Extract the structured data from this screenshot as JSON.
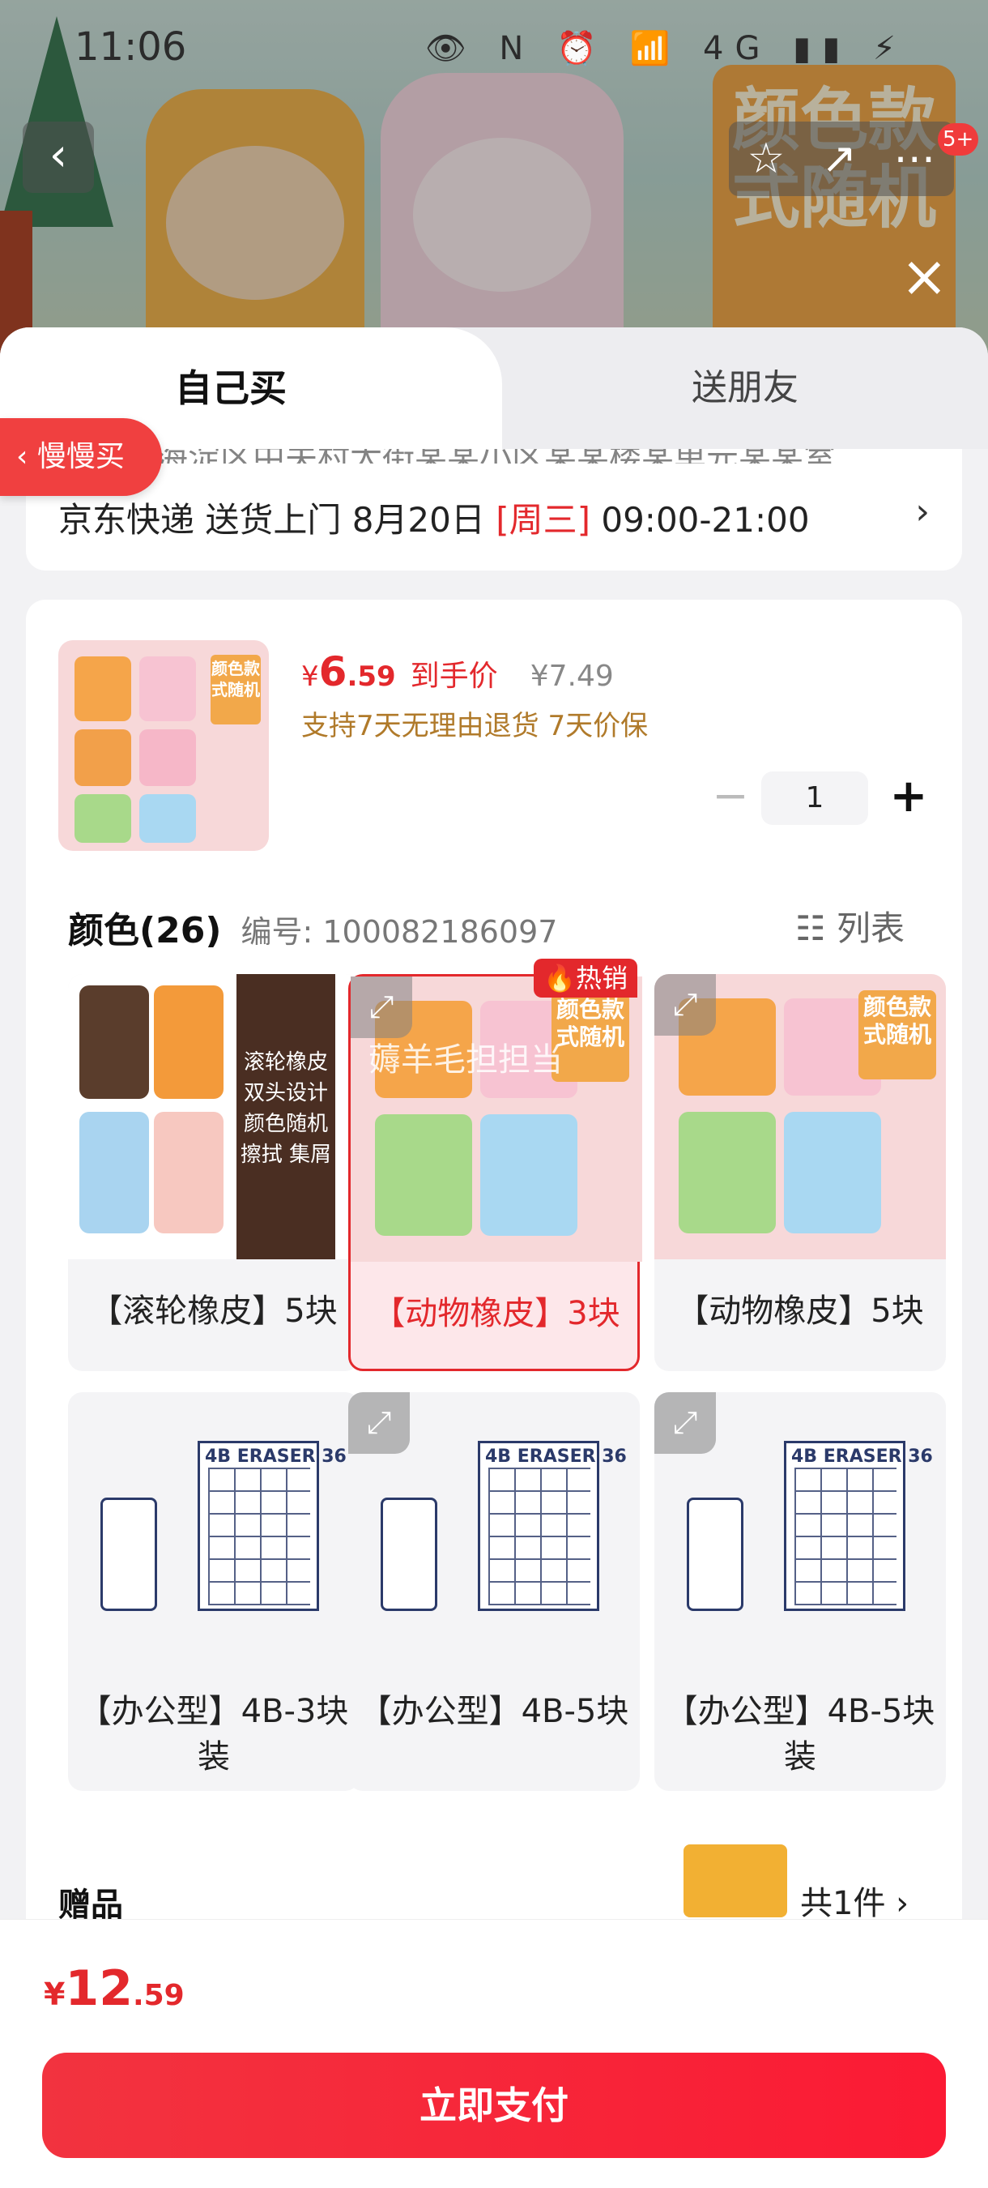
{
  "status_bar": {
    "time": "11:06",
    "icons_text": "👁 N ⏰ 📶 4G ▮▮ ⚡"
  },
  "header": {
    "back_icon": "‹",
    "actions": [
      "☆",
      "↗",
      "⋯"
    ],
    "badge": "5+",
    "close_icon": "×"
  },
  "background_label": "颜色款式随机",
  "tabs": {
    "self": "自己买",
    "friend": "送朋友"
  },
  "delivery": {
    "truncated": "北京市海淀区中关村大街某某小区某某楼某单元某某室",
    "carrier": "京东快递 送货上门 8月20日 ",
    "weekday": "[周三]",
    "time_window": " 09:00-21:00",
    "chevron": "›"
  },
  "product": {
    "thumb_tag": "颜色款式随机",
    "currency": "¥",
    "price_int": "6",
    "price_dec": ".59",
    "price_label": "到手价",
    "original_price": "¥7.49",
    "guarantee": "支持7天无理由退货  7天价保",
    "quantity": "1",
    "minus": "−",
    "plus": "+"
  },
  "slow_buy": "‹  慢慢买",
  "colors": {
    "title": "颜色(26)",
    "code": "编号: 100082186097",
    "list_toggle": "☷ 列表",
    "options": [
      {
        "name": "【滚轮橡皮】5块",
        "selected": false,
        "side_tag": "滚轮橡皮 双头设计 颜色随机 擦拭 集屑"
      },
      {
        "name": "【动物橡皮】3块",
        "selected": true,
        "hot": "🔥热销",
        "watermark": "薅羊毛担担当"
      },
      {
        "name": "【动物橡皮】5块",
        "selected": false
      },
      {
        "name": "【办公型】4B-3块装",
        "selected": false
      },
      {
        "name": "【办公型】4B-5块",
        "selected": false
      },
      {
        "name": "【办公型】4B-5块装",
        "selected": false
      }
    ],
    "expand_icon": "⤢",
    "pack_header": "4B ERASER 36"
  },
  "gift": {
    "label": "赠品",
    "count": "共1件  ›"
  },
  "footer": {
    "currency": "¥",
    "total_int": "12",
    "total_dec": ".59",
    "pay_label": "立即支付"
  }
}
